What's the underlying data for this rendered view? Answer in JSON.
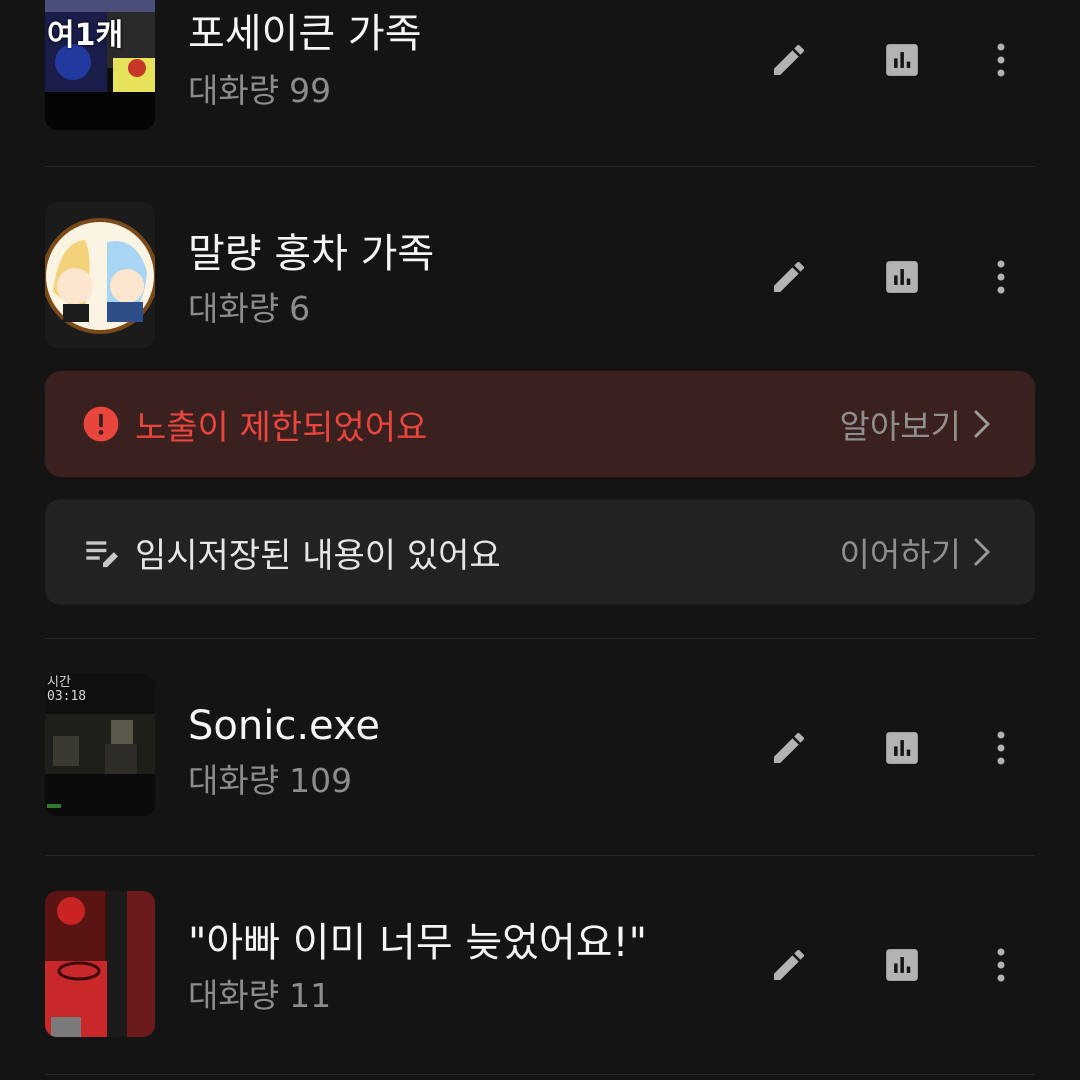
{
  "theme": {
    "background": "#141414",
    "title_color": "#f5f5f5",
    "meta_color": "#8c8c8c",
    "warning_color": "#e8453c",
    "warning_bg": "#3b2020",
    "draft_bg": "#222222"
  },
  "items": [
    {
      "title": "포세이큰 가족",
      "meta_label": "대화량",
      "meta_value": "99",
      "thumbnail_text": "여1캐",
      "actions": [
        "edit-icon",
        "stats-icon",
        "more-icon"
      ]
    },
    {
      "title": "말량 홍차 가족",
      "meta_label": "대화량",
      "meta_value": "6",
      "actions": [
        "edit-icon",
        "stats-icon",
        "more-icon"
      ]
    },
    {
      "title": "Sonic.exe",
      "meta_label": "대화량",
      "meta_value": "109",
      "thumbnail_text": "시간 03:18",
      "actions": [
        "edit-icon",
        "stats-icon",
        "more-icon"
      ]
    },
    {
      "title": "\"아빠 이미 너무 늦었어요!\"",
      "meta_label": "대화량",
      "meta_value": "11",
      "actions": [
        "edit-icon",
        "stats-icon",
        "more-icon"
      ]
    }
  ],
  "banners": {
    "restricted": {
      "text": "노출이 제한되었어요",
      "action": "알아보기",
      "icon": "alert-circle-icon"
    },
    "draft": {
      "text": "임시저장된 내용이 있어요",
      "action": "이어하기",
      "icon": "draft-edit-icon"
    }
  }
}
